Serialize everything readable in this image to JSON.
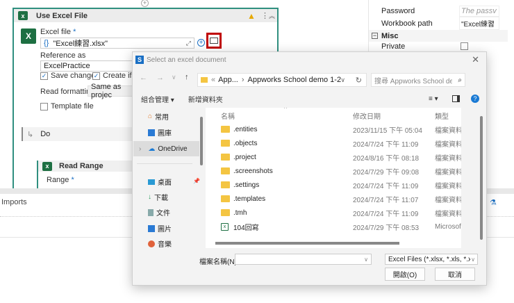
{
  "workflow": {
    "add_icon": "plus-circle-icon",
    "card_title": "Use Excel File",
    "excel_file_label": "Excel file",
    "required_mark": "*",
    "excel_file_value": "\"Excel練習.xlsx\"",
    "reference_label": "Reference as",
    "reference_value": "ExcelPractice",
    "save_changes": "Save changes",
    "create_if": "Create if no",
    "read_formatting_label": "Read formatting",
    "read_formatting_value": "Same as projec",
    "template_file": "Template file",
    "do_label": "Do",
    "read_range_title": "Read Range",
    "range_label": "Range",
    "imports_label": "Imports"
  },
  "properties": {
    "rows": [
      {
        "label": "Password",
        "value": "The passv"
      },
      {
        "label": "Workbook path",
        "value": "\"Excel練習"
      }
    ],
    "misc_header": "Misc",
    "private_label": "Private"
  },
  "dialog": {
    "title": "Select an excel document",
    "breadcrumb": [
      "App...",
      "Appworks School demo 1-2"
    ],
    "search_placeholder": "搜尋 Appworks School de...",
    "organize": "組合管理",
    "new_folder": "新增資料夾",
    "sidebar": [
      "常用",
      "圖庫",
      "OneDrive",
      "桌面",
      "下載",
      "文件",
      "圖片",
      "音樂"
    ],
    "columns": {
      "name": "名稱",
      "date": "修改日期",
      "type": "類型"
    },
    "files": [
      {
        "name": ".entities",
        "date": "2023/11/15 下午 05:04",
        "type": "檔案資料夾",
        "kind": "folder"
      },
      {
        "name": ".objects",
        "date": "2024/7/24 下午 11:09",
        "type": "檔案資料夾",
        "kind": "folder"
      },
      {
        "name": ".project",
        "date": "2024/8/16 下午 08:18",
        "type": "檔案資料夾",
        "kind": "folder"
      },
      {
        "name": ".screenshots",
        "date": "2024/7/29 下午 09:08",
        "type": "檔案資料夾",
        "kind": "folder"
      },
      {
        "name": ".settings",
        "date": "2024/7/24 下午 11:09",
        "type": "檔案資料夾",
        "kind": "folder"
      },
      {
        "name": ".templates",
        "date": "2024/7/24 下午 11:07",
        "type": "檔案資料夾",
        "kind": "folder"
      },
      {
        "name": ".tmh",
        "date": "2024/7/24 下午 11:09",
        "type": "檔案資料夾",
        "kind": "folder"
      },
      {
        "name": "104回寫",
        "date": "2024/7/29 下午 08:53",
        "type": "Microsoft Ex",
        "kind": "excel"
      }
    ],
    "filename_label": "檔案名稱(N):",
    "filename_value": "",
    "filter": "Excel Files (*.xlsx, *.xls, *.xlsm,",
    "open": "開啟(O)",
    "cancel": "取消"
  },
  "colors": {
    "accent": "#2f8f7f",
    "highlight": "#c00000",
    "excel": "#1d6f42"
  }
}
